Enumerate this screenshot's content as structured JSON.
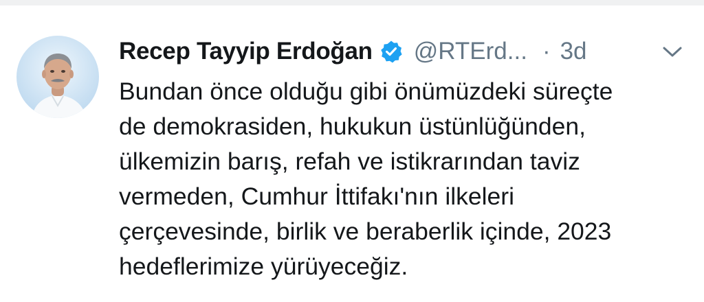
{
  "tweet": {
    "author_name": "Recep Tayyip Erdoğan",
    "handle": "@RTErd...",
    "separator": "·",
    "time": "3d",
    "text_lines": [
      "Bundan önce olduğu gibi önümüzdeki süreçte",
      "de demokrasiden, hukukun üstünlüğünden,",
      "ülkemizin barış, refah ve istikrarından taviz",
      "vermeden, Cumhur İttifakı'nın ilkeleri",
      "çerçevesinde, birlik ve beraberlik içinde, 2023",
      "hedeflerimize yürüyeceğiz."
    ]
  },
  "icons": {
    "verified": "verified-badge-icon",
    "caret": "chevron-down-icon"
  },
  "colors": {
    "verified_blue": "#1da1f2",
    "text_primary": "#14171a",
    "text_secondary": "#657786",
    "avatar_background": "#cfe3f4"
  }
}
